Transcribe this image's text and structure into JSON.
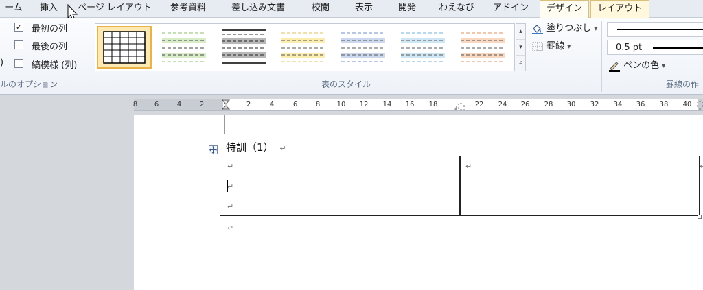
{
  "tabs": [
    {
      "label": "ーム"
    },
    {
      "label": "挿入"
    },
    {
      "label": "ページ レイアウト"
    },
    {
      "label": "参考資料"
    },
    {
      "label": "差し込み文書"
    },
    {
      "label": "校閲"
    },
    {
      "label": "表示"
    },
    {
      "label": "開発"
    },
    {
      "label": "わえなび"
    },
    {
      "label": "アドイン"
    },
    {
      "label": "デザイン"
    },
    {
      "label": "レイアウト"
    }
  ],
  "options_group": {
    "items": [
      {
        "label": "最初の列",
        "checked": true,
        "check_glyph": "✓"
      },
      {
        "label": "最後の列",
        "checked": false,
        "check_glyph": ""
      },
      {
        "label": "縞模様 (列)",
        "checked": false,
        "check_glyph": ""
      }
    ],
    "cut_paren": ")",
    "label": "ルのオプション"
  },
  "styles_group": {
    "label": "表のスタイル"
  },
  "shading_label": "塗りつぶし",
  "borders_label": "罫線",
  "pen_color_label": "ペンの色",
  "dropdown_glyph": "▾",
  "line_weight": "0.5 pt",
  "borders_group_label": "罫線の作",
  "ruler_labels": [
    "8",
    "6",
    "4",
    "2",
    "2",
    "4",
    "6",
    "8",
    "10",
    "12",
    "14",
    "16",
    "18",
    "22",
    "24",
    "26",
    "28",
    "30",
    "32",
    "34",
    "36",
    "38",
    "40"
  ],
  "document": {
    "title": "特訓（1）",
    "para_mark": "↵"
  },
  "colors": {
    "accent": "#e9b24a",
    "ribbon_bg": "#eef2f8",
    "page": "#ffffff"
  }
}
